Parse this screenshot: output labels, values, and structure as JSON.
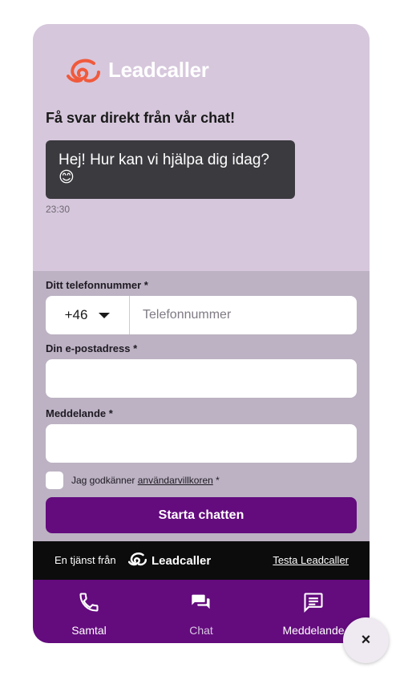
{
  "brand": {
    "name": "Leadcaller",
    "accent": "#640b7e",
    "logo_color": "#f05a3c"
  },
  "chat": {
    "headline": "Få svar direkt från vår chat!",
    "message": "Hej! Hur kan vi hjälpa dig idag? 😊",
    "timestamp": "23:30"
  },
  "form": {
    "phone_label": "Ditt telefonnummer *",
    "country_code": "+46",
    "phone_placeholder": "Telefonnummer",
    "email_label": "Din e-postadress *",
    "email_value": "",
    "message_label": "Meddelande *",
    "message_value": "",
    "consent_prefix": "Jag godkänner ",
    "consent_link": "användarvillkoren",
    "consent_suffix": " *",
    "submit_label": "Starta chatten"
  },
  "footer": {
    "service_text": "En tjänst från",
    "logo_text": "Leadcaller",
    "try_link": "Testa Leadcaller"
  },
  "nav": {
    "items": [
      {
        "label": "Samtal",
        "icon": "phone-icon"
      },
      {
        "label": "Chat",
        "icon": "chat-icon"
      },
      {
        "label": "Meddelande",
        "icon": "message-icon"
      }
    ]
  },
  "close": {
    "label": "×",
    "icon": "close-icon"
  }
}
